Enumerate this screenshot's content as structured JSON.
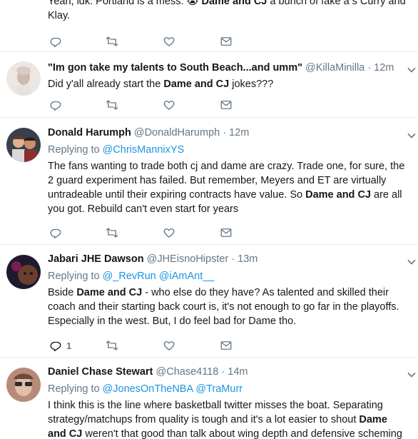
{
  "tweets": [
    {
      "text_parts": [
        "Yeah, idk. Portland is a mess. ",
        "😭",
        " ",
        "Dame and CJ",
        " a bunch of fake a",
        " s Curry and",
        "Klay."
      ]
    },
    {
      "name": "\"Im gon take my talents to South Beach...and umm\"",
      "handle": "@KillaMinilla",
      "time": "12m",
      "text_pre": "Did y'all already start the ",
      "text_bold": "Dame and CJ",
      "text_post": " jokes???"
    },
    {
      "name": "Donald Harumph",
      "handle": "@DonaldHarumph",
      "time": "12m",
      "replying_label": "Replying to ",
      "replying_to": "@ChrisMannixYS",
      "text_pre": "The fans wanting to trade both cj and dame are crazy.  Trade one, for sure, the 2 guard experiment has failed. But remember, Meyers and ET are virtually untradeable until their expiring contracts have value. So ",
      "text_bold": "Dame and CJ",
      "text_post": " are all you got. Rebuild can't even start for years"
    },
    {
      "name": "Jabari JHE Dawson",
      "handle": "@JHEisnoHipster",
      "time": "13m",
      "replying_label": "Replying to ",
      "replying_to": "@_RevRun",
      "replying_and": " @iAmAnt__",
      "text_pre": "Bside ",
      "text_bold": "Dame and CJ",
      "text_post": " - who else do they have? As talented and skilled their coach and their starting back court is, it's not enough to go far in the playoffs. Especially in the west. But, I do feel bad for Dame tho.",
      "reply_count": "1"
    },
    {
      "name": "Daniel Chase Stewart",
      "handle": "@Chase4118",
      "time": "14m",
      "replying_label": "Replying to ",
      "replying_to": "@JonesOnTheNBA",
      "replying_and": " @TraMurr",
      "text_pre": "I think this is the line where basketball twitter misses the boat. Separating strategy/matchups from quality is tough and it's a lot easier to shout ",
      "text_bold": "Dame and CJ",
      "text_post": " weren't that good than talk about wing depth and defensive scheming limiting"
    }
  ],
  "dot": "·",
  "colors": {
    "link": "#1b95e0",
    "muted": "#657786",
    "border": "#e6ecf0"
  },
  "icons": [
    "reply-icon",
    "retweet-icon",
    "like-icon",
    "direct-message-icon",
    "chevron-down-icon"
  ]
}
